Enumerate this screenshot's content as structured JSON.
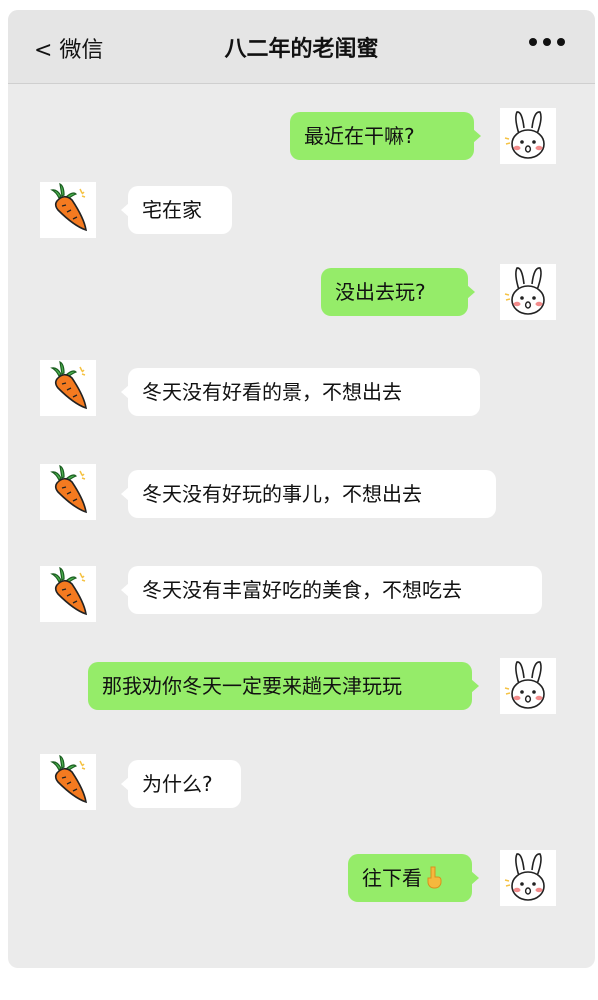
{
  "nav": {
    "back_label": "< 微信",
    "title": "八二年的老闺蜜"
  },
  "messages": [
    {
      "side": "right",
      "text": "最近在干嘛?"
    },
    {
      "side": "left",
      "text": "宅在家"
    },
    {
      "side": "right",
      "text": "没出去玩?"
    },
    {
      "side": "left",
      "text": "冬天没有好看的景，不想出去"
    },
    {
      "side": "left",
      "text": "冬天没有好玩的事儿，不想出去"
    },
    {
      "side": "left",
      "text": "冬天没有丰富好吃的美食，不想吃去"
    },
    {
      "side": "right",
      "text": "那我劝你冬天一定要来趟天津玩玩"
    },
    {
      "side": "left",
      "text": "为什么?"
    },
    {
      "side": "right",
      "text": "往下看",
      "emoji": "pointing-down-hand-icon"
    }
  ],
  "avatars": {
    "left": "carrot-icon",
    "right": "bunny-icon"
  },
  "colors": {
    "right_bubble": "#95ec69",
    "left_bubble": "#ffffff",
    "background": "#ebebeb"
  }
}
